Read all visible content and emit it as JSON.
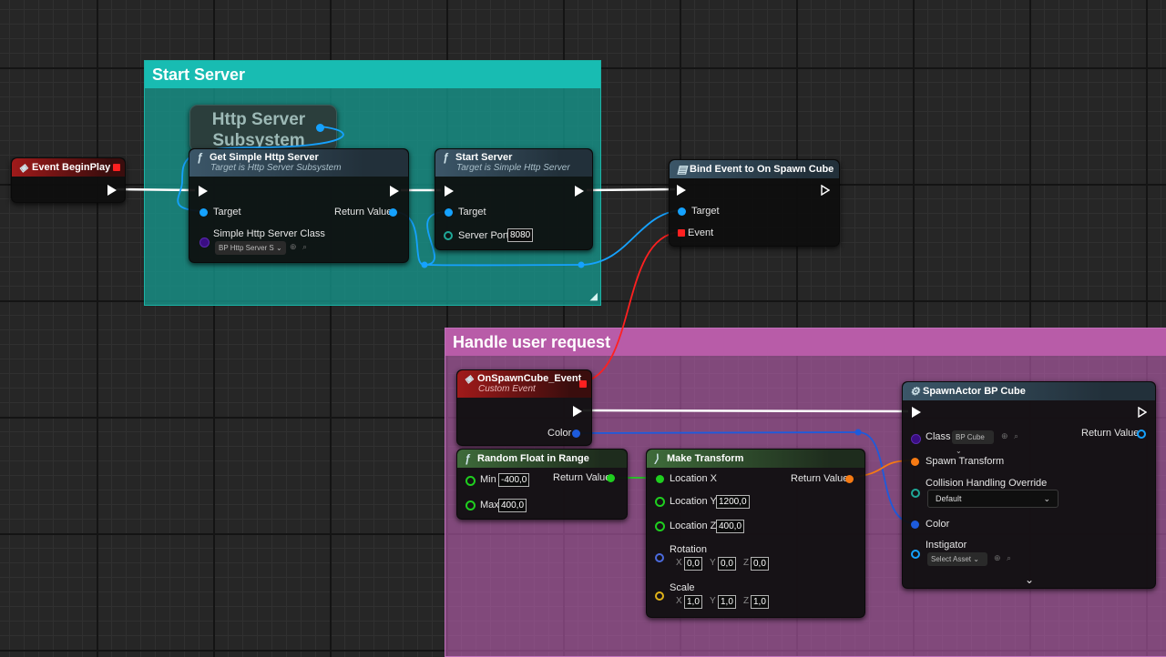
{
  "comments": {
    "start_server": "Start Server",
    "handle_request": "Handle user request"
  },
  "nodes": {
    "event_begin_play": {
      "title": "Event BeginPlay"
    },
    "http_subsystem": {
      "line1": "Http Server",
      "line2": "Subsystem"
    },
    "get_simple_http_server": {
      "title": "Get Simple Http Server",
      "subtitle": "Target is Http Server Subsystem",
      "target": "Target",
      "return_value": "Return Value",
      "class_label": "Simple Http Server Class",
      "class_value": "BP Http Server S"
    },
    "start_server": {
      "title": "Start Server",
      "subtitle": "Target is Simple Http Server",
      "target": "Target",
      "port_label": "Server Port",
      "port_value": "8080"
    },
    "bind_event": {
      "title": "Bind Event to On Spawn Cube",
      "target": "Target",
      "event": "Event"
    },
    "on_spawn_cube_event": {
      "title": "OnSpawnCube_Event",
      "subtitle": "Custom Event",
      "color": "Color"
    },
    "random_float": {
      "title": "Random Float in Range",
      "min_label": "Min",
      "min_value": "-400,0",
      "max_label": "Max",
      "max_value": "400,0",
      "return_value": "Return Value"
    },
    "make_transform": {
      "title": "Make Transform",
      "location_x": "Location X",
      "location_y": "Location Y",
      "location_y_value": "1200,0",
      "location_z": "Location Z",
      "location_z_value": "400,0",
      "return_value": "Return Value",
      "rotation": "Rotation",
      "rotation_values": [
        "0,0",
        "0,0",
        "0,0"
      ],
      "scale": "Scale",
      "scale_values": [
        "1,0",
        "1,0",
        "1,0"
      ],
      "axes": [
        "X",
        "Y",
        "Z"
      ]
    },
    "spawn_actor": {
      "title": "SpawnActor BP Cube",
      "class_label": "Class",
      "class_value": "BP Cube",
      "return_value": "Return Value",
      "spawn_transform": "Spawn Transform",
      "collision_label": "Collision Handling Override",
      "collision_value": "Default",
      "color": "Color",
      "instigator": "Instigator",
      "instigator_value": "Select Asset"
    }
  },
  "colors": {
    "exec_wire": "#ffffff",
    "object_pin": "#15a2ff",
    "struct_pin": "#1d5bdc",
    "float_pin": "#1fce1f",
    "transform_pin": "#f67a13",
    "delegate_pin": "#ff2020",
    "start_comment": "#18bcb2",
    "handle_comment": "#b85ca8"
  },
  "icons": {
    "function": "function-icon",
    "event": "event-diamond-icon",
    "bind": "bind-event-icon",
    "spawn": "spawn-actor-icon",
    "pure": "pure-function-icon",
    "search": "search-icon",
    "use": "use-selected-icon",
    "expand": "chevron-down-icon"
  }
}
